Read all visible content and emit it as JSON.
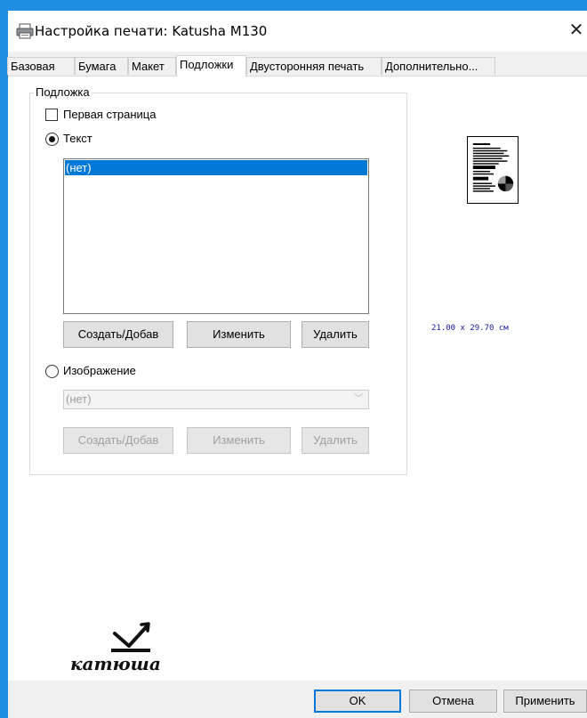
{
  "window": {
    "title": "Настройка печати: Katusha M130",
    "close_glyph": "✕"
  },
  "tabs": [
    {
      "label": "Базовая",
      "active": false
    },
    {
      "label": "Бумага",
      "active": false
    },
    {
      "label": "Макет",
      "active": false
    },
    {
      "label": "Подложки",
      "active": true
    },
    {
      "label": "Двусторонняя печать",
      "active": false
    },
    {
      "label": "Дополнительно...",
      "active": false
    }
  ],
  "watermark_group": {
    "legend": "Подложка",
    "first_page": {
      "label": "Первая страница",
      "checked": false
    },
    "text_option": {
      "label": "Текст",
      "selected": true
    },
    "text_list": {
      "items": [
        "(нет)"
      ],
      "selected_index": 0
    },
    "text_buttons": {
      "create": "Создать/Добав",
      "edit": "Изменить",
      "delete": "Удалить"
    },
    "image_option": {
      "label": "Изображение",
      "selected": false
    },
    "image_combo": {
      "value": "(нет)",
      "disabled": true
    },
    "image_buttons": {
      "create": "Создать/Добав",
      "edit": "Изменить",
      "delete": "Удалить",
      "disabled": true
    }
  },
  "preview": {
    "paper_size_text": "21.00 x 29.70 см"
  },
  "logo": {
    "text": "катюша"
  },
  "footer": {
    "ok": "OK",
    "cancel": "Отмена",
    "apply": "Применить"
  },
  "colors": {
    "accent": "#0078d7",
    "frame": "#1e8fe0",
    "size_text": "#1a1aa6"
  }
}
